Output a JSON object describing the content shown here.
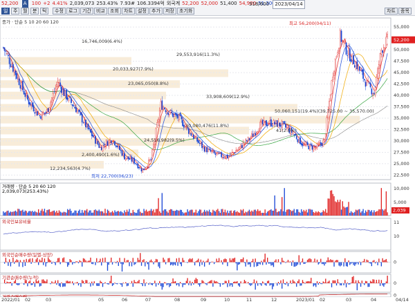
{
  "toolbar": {
    "code": "52,200",
    "name_badge": "A",
    "row1": [
      {
        "text": "100",
        "cls": "up"
      },
      {
        "text": "+2",
        "cls": "up"
      },
      {
        "text": "4.41%",
        "cls": "up"
      },
      {
        "text": "2,039,073",
        "cls": ""
      },
      {
        "text": "253.43%",
        "cls": ""
      },
      {
        "text": "7.93#",
        "cls": ""
      },
      {
        "text": "106.3394억",
        "cls": ""
      },
      {
        "text": "외국계",
        "cls": ""
      },
      {
        "text": "52,200",
        "cls": "up"
      },
      {
        "text": "52,000",
        "cls": "up"
      },
      {
        "text": "51,400",
        "cls": ""
      },
      {
        "text": "54,900",
        "cls": "up"
      },
      {
        "text": "51,300",
        "cls": "dn"
      }
    ],
    "counter": "318/600",
    "date": "2023/04/14",
    "row2_tabs": [
      "일",
      "주",
      "월",
      "분",
      "틱"
    ],
    "row2_buttons": [
      "수정",
      "로그",
      "기간",
      "비교"
    ],
    "row2_extra": [
      "조회",
      "차트",
      "설정",
      "추가",
      "저장",
      "초기화"
    ],
    "right_btns": [
      "차트",
      "종목"
    ]
  },
  "price_panel": {
    "legend": "종가 · 단순 5 10 20 60 120",
    "y_ticks": [
      "55,000",
      "52,500",
      "50,000",
      "47,500",
      "45,000",
      "42,500",
      "40,000",
      "37,500",
      "35,000",
      "32,500",
      "30,000",
      "27,500",
      "25,000",
      "22,500"
    ],
    "y_values": [
      55000,
      52500,
      50000,
      47500,
      45000,
      42500,
      40000,
      37500,
      35000,
      32500,
      30000,
      27500,
      25000,
      22500
    ],
    "current_price": "52,200",
    "annotations": [
      {
        "text": "16,746,009(6.4%)"
      },
      {
        "text": "29,553,916(11.3%)"
      },
      {
        "text": "20,033,927(7.9%)"
      },
      {
        "text": "23,065,050(8.8%)"
      },
      {
        "text": "33,908,609(12.9%)"
      },
      {
        "text": "50,060,151(19.4%)(39,725.00 ~ 35,570.00)"
      },
      {
        "text": "30,080,476(11.8%)"
      },
      {
        "text": "24,516,982(9.5%)"
      },
      {
        "text": "2,400,490(1.6%)"
      },
      {
        "text": "41(2.0%)"
      },
      {
        "text": "12,234,563(4.7%)"
      }
    ],
    "high_label": "최고 56,200(04/11)",
    "low_label": "최저 22,700(06/23)"
  },
  "volume_panel": {
    "legend": "거래량 · 단순 5 20 60 120",
    "value": "2,039,073(253.43%)",
    "y_ticks": [
      "10,000",
      "5,000"
    ],
    "badge": "2,039"
  },
  "indicators": [
    {
      "label": "외국인보유비율",
      "ticks": [
        "11",
        "10"
      ]
    },
    {
      "label": "외국인순매수량(일별-상장)",
      "ticks": [
        "0"
      ]
    },
    {
      "label": "기관순매수량(누적)",
      "ticks": [
        "0"
      ]
    },
    {
      "label": "기관순매수량",
      "ticks": [
        "0"
      ]
    }
  ],
  "x_axis": [
    "2022/01",
    "02",
    "03",
    "05",
    "06",
    "07",
    "08",
    "09",
    "10",
    "11",
    "12",
    "2023/01",
    "02",
    "03",
    "04",
    "04/14"
  ],
  "colors": {
    "up": "#e02020",
    "down": "#1a47d6",
    "ma5": "#e02020",
    "ma10": "#1a47d6",
    "ma20": "#f0a800",
    "ma60": "#1f9a2a",
    "ma120": "#888888",
    "band": "#f7e9d2"
  }
}
